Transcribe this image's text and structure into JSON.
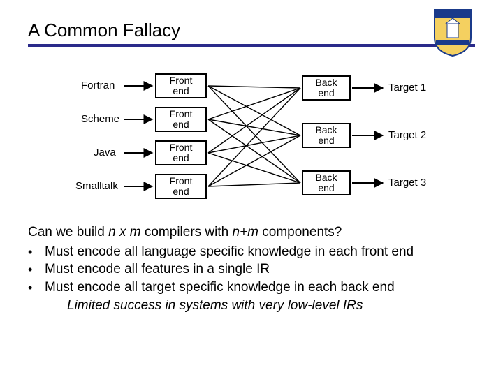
{
  "title": "A Common Fallacy",
  "logo_alt": "University of Delaware crest",
  "diagram": {
    "languages": [
      "Fortran",
      "Scheme",
      "Java",
      "Smalltalk"
    ],
    "front_end_label": "Front\nend",
    "back_end_label": "Back\nend",
    "targets": [
      "Target 1",
      "Target 2",
      "Target 3"
    ]
  },
  "question_prefix": "Can we build ",
  "question_em1": "n x m",
  "question_mid": " compilers with ",
  "question_em2": "n+m",
  "question_suffix": " components?",
  "bullets": [
    "Must encode all language specific knowledge in each front end",
    "Must encode all features in a single IR",
    "Must encode all target specific knowledge in each back end"
  ],
  "tail_line": "Limited success in systems with very low-level IRs",
  "chart_data": {
    "type": "diagram",
    "title": "A Common Fallacy",
    "left_inputs": [
      "Fortran",
      "Scheme",
      "Java",
      "Smalltalk"
    ],
    "left_boxes": [
      "Front end",
      "Front end",
      "Front end",
      "Front end"
    ],
    "right_boxes": [
      "Back end",
      "Back end",
      "Back end"
    ],
    "right_outputs": [
      "Target 1",
      "Target 2",
      "Target 3"
    ],
    "edges": "fully-connected bipartite between 4 front ends and 3 back ends",
    "arrows_in": "each language -> its front end",
    "arrows_out": "each back end -> its target"
  }
}
